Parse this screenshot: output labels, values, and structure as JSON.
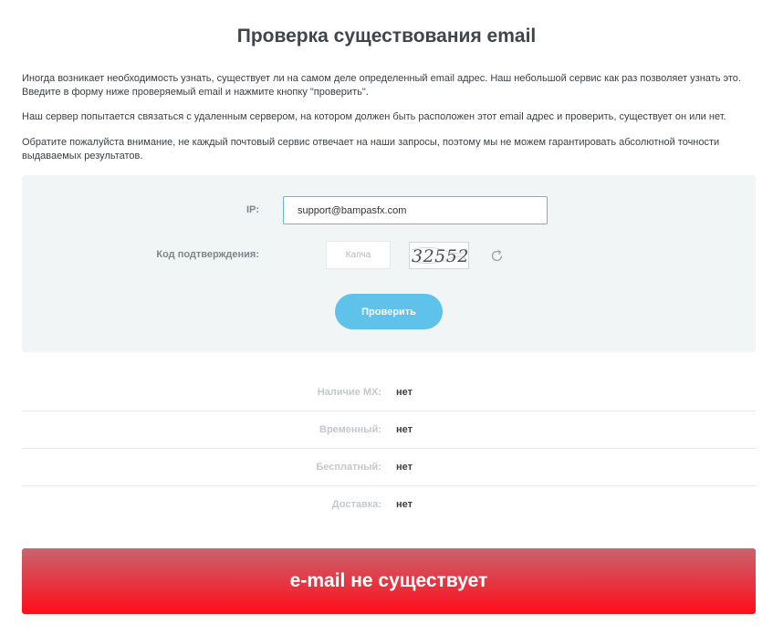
{
  "page": {
    "title": "Проверка существования email",
    "intro": [
      "Иногда возникает необходимость узнать, существует ли на самом деле определенный email адрес. Наш небольшой сервис как раз позволяет узнать это. Введите в форму ниже проверяемый email и нажмите кнопку \"проверить\".",
      "Наш сервер попытается связаться с удаленным сервером, на котором должен быть расположен этот email адрес и проверить, существует он или нет.",
      "Обратите пожалуйста внимание, не каждый почтовый сервис отвечает на наши запросы, поэтому мы не можем гарантировать абсолютной точности выдаваемых результатов."
    ]
  },
  "form": {
    "ip_label": "IP:",
    "email_value": "support@bampasfx.com",
    "code_label": "Код подтверждения:",
    "captcha_placeholder": "Капча",
    "captcha_text": "32552",
    "submit_label": "Проверить"
  },
  "results": [
    {
      "label": "Наличие MX:",
      "value": "нет"
    },
    {
      "label": "Временный:",
      "value": "нет"
    },
    {
      "label": "Бесплатный:",
      "value": "нет"
    },
    {
      "label": "Доставка:",
      "value": "нет"
    }
  ],
  "verdict": {
    "text": "e-mail не существует"
  },
  "colors": {
    "accent": "#5ec2ea",
    "verdict_top": "#c8646e",
    "verdict_bottom": "#ff0d1a",
    "panel_bg": "#f2f5f6"
  },
  "icons": {
    "refresh": "refresh-icon"
  }
}
